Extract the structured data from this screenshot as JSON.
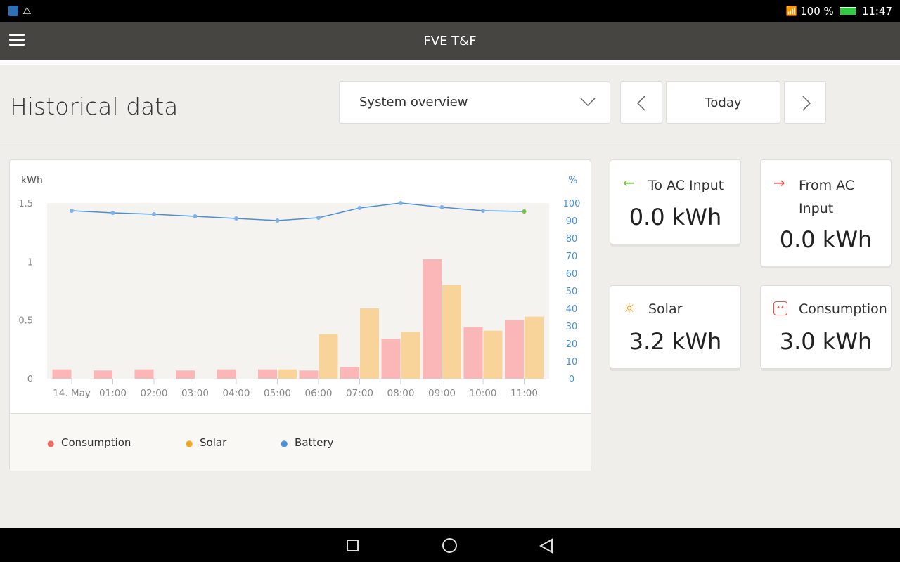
{
  "status_bar": {
    "battery": "100 %",
    "time": "11:47",
    "icons": [
      "app-icon",
      "warning-icon",
      "wifi-icon",
      "battery-icon"
    ]
  },
  "app_bar": {
    "title": "FVE T&F",
    "menu_icon": "hamburger-icon"
  },
  "page": {
    "title": "Historical data"
  },
  "controls": {
    "view_select": "System overview",
    "period": "Today",
    "prev_icon": "chevron-left-icon",
    "next_icon": "chevron-right-icon"
  },
  "cards": [
    {
      "label": "To AC Input",
      "value": "0.0 kWh",
      "icon": "arrow-left-icon",
      "color": "#7ac143"
    },
    {
      "label": "From AC Input",
      "value": "0.0 kWh",
      "icon": "arrow-right-icon",
      "color": "#e8524a"
    },
    {
      "label": "Solar",
      "value": "3.2 kWh",
      "icon": "sun-icon",
      "color": "#f5a623"
    },
    {
      "label": "Consumption",
      "value": "3.0 kWh",
      "icon": "socket-icon",
      "color": "#e8524a"
    }
  ],
  "chart_data": {
    "type": "bar",
    "ylabel": "kWh",
    "y2label": "%",
    "ylim": [
      0,
      1.5
    ],
    "y2lim": [
      0,
      100
    ],
    "yticks": [
      "0",
      "0.5",
      "1",
      "1.5"
    ],
    "y2ticks": [
      "0",
      "10",
      "20",
      "30",
      "40",
      "50",
      "60",
      "70",
      "80",
      "90",
      "100"
    ],
    "categories": [
      "14. May",
      "01:00",
      "02:00",
      "03:00",
      "04:00",
      "05:00",
      "06:00",
      "07:00",
      "08:00",
      "09:00",
      "10:00",
      "11:00"
    ],
    "series": [
      {
        "name": "Consumption",
        "color": "#fbb7b7",
        "values": [
          0.08,
          0.07,
          0.08,
          0.07,
          0.08,
          0.08,
          0.07,
          0.1,
          0.34,
          1.02,
          0.44,
          0.5
        ]
      },
      {
        "name": "Solar",
        "color": "#f9d49a",
        "values": [
          0,
          0,
          0,
          0,
          0,
          0.08,
          0.38,
          0.6,
          0.4,
          0.8,
          0.41,
          0.53
        ]
      },
      {
        "name": "Battery",
        "color": "#4a90d9",
        "axis": "right",
        "values": [
          95.6,
          94.4,
          93.6,
          92.4,
          91.2,
          90,
          91.6,
          97.2,
          100,
          97.6,
          95.6,
          95.2
        ]
      }
    ],
    "legend": [
      {
        "label": "Consumption",
        "color": "#f26b6b"
      },
      {
        "label": "Solar",
        "color": "#f5a623"
      },
      {
        "label": "Battery",
        "color": "#4a90d9"
      }
    ]
  }
}
